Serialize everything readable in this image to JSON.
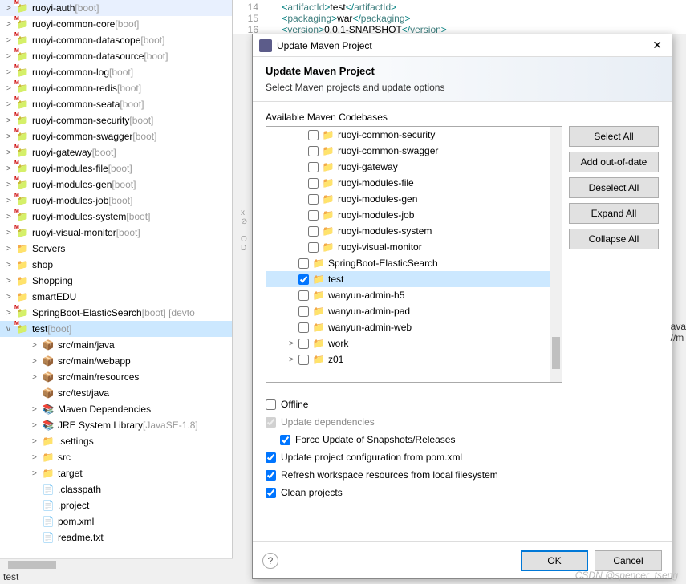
{
  "sidebar": {
    "projects": [
      {
        "name": "ruoyi-auth",
        "suffix": "[boot]",
        "icon": "maven-folder",
        "expand": ">"
      },
      {
        "name": "ruoyi-common-core",
        "suffix": "[boot]",
        "icon": "maven-folder",
        "expand": ">"
      },
      {
        "name": "ruoyi-common-datascope",
        "suffix": "[boot]",
        "icon": "maven-folder",
        "expand": ">"
      },
      {
        "name": "ruoyi-common-datasource",
        "suffix": "[boot]",
        "icon": "maven-folder",
        "expand": ">"
      },
      {
        "name": "ruoyi-common-log",
        "suffix": "[boot]",
        "icon": "maven-folder",
        "expand": ">"
      },
      {
        "name": "ruoyi-common-redis",
        "suffix": "[boot]",
        "icon": "maven-folder",
        "expand": ">"
      },
      {
        "name": "ruoyi-common-seata",
        "suffix": "[boot]",
        "icon": "maven-folder",
        "expand": ">"
      },
      {
        "name": "ruoyi-common-security",
        "suffix": "[boot]",
        "icon": "maven-folder",
        "expand": ">"
      },
      {
        "name": "ruoyi-common-swagger",
        "suffix": "[boot]",
        "icon": "maven-folder",
        "expand": ">"
      },
      {
        "name": "ruoyi-gateway",
        "suffix": "[boot]",
        "icon": "maven-folder",
        "expand": ">"
      },
      {
        "name": "ruoyi-modules-file",
        "suffix": "[boot]",
        "icon": "maven-folder",
        "expand": ">"
      },
      {
        "name": "ruoyi-modules-gen",
        "suffix": "[boot]",
        "icon": "maven-folder",
        "expand": ">"
      },
      {
        "name": "ruoyi-modules-job",
        "suffix": "[boot]",
        "icon": "maven-folder",
        "expand": ">"
      },
      {
        "name": "ruoyi-modules-system",
        "suffix": "[boot]",
        "icon": "maven-folder",
        "expand": ">"
      },
      {
        "name": "ruoyi-visual-monitor",
        "suffix": "[boot]",
        "icon": "maven-folder",
        "expand": ">"
      },
      {
        "name": "Servers",
        "suffix": "",
        "icon": "folder",
        "expand": ">"
      },
      {
        "name": "shop",
        "suffix": "",
        "icon": "folder",
        "expand": ">"
      },
      {
        "name": "Shopping",
        "suffix": "",
        "icon": "folder",
        "expand": ">"
      },
      {
        "name": "smartEDU",
        "suffix": "",
        "icon": "folder",
        "expand": ">"
      },
      {
        "name": "SpringBoot-ElasticSearch",
        "suffix": "[boot] [devto",
        "icon": "maven-folder",
        "expand": ">"
      }
    ],
    "expanded_project": {
      "name": "test",
      "suffix": "[boot]",
      "icon": "maven-folder",
      "expand": "v"
    },
    "children": [
      {
        "name": "src/main/java",
        "icon": "package",
        "expand": ">"
      },
      {
        "name": "src/main/webapp",
        "icon": "package",
        "expand": ">"
      },
      {
        "name": "src/main/resources",
        "icon": "package",
        "expand": ">"
      },
      {
        "name": "src/test/java",
        "icon": "package",
        "expand": ""
      },
      {
        "name": "Maven Dependencies",
        "icon": "library",
        "expand": ">"
      },
      {
        "name": "JRE System Library",
        "suffix": "[JavaSE-1.8]",
        "icon": "library",
        "expand": ">"
      },
      {
        "name": ".settings",
        "icon": "folder",
        "expand": ">"
      },
      {
        "name": "src",
        "icon": "folder",
        "expand": ">"
      },
      {
        "name": "target",
        "icon": "folder",
        "expand": ">"
      },
      {
        "name": ".classpath",
        "icon": "xml-file",
        "expand": ""
      },
      {
        "name": ".project",
        "icon": "xml-file",
        "expand": ""
      },
      {
        "name": "pom.xml",
        "icon": "pom-file",
        "expand": ""
      },
      {
        "name": "readme.txt",
        "icon": "text-file",
        "expand": ""
      }
    ],
    "status": "test"
  },
  "editor": {
    "lines": [
      {
        "num": "14",
        "content": [
          {
            "t": "tag",
            "v": "<"
          },
          {
            "t": "tagname",
            "v": "artifactId"
          },
          {
            "t": "tag",
            "v": ">"
          },
          {
            "t": "text",
            "v": "test"
          },
          {
            "t": "tag",
            "v": "</"
          },
          {
            "t": "tagname",
            "v": "artifactId"
          },
          {
            "t": "tag",
            "v": ">"
          }
        ]
      },
      {
        "num": "15",
        "content": [
          {
            "t": "tag",
            "v": "<"
          },
          {
            "t": "tagname",
            "v": "packaging"
          },
          {
            "t": "tag",
            "v": ">"
          },
          {
            "t": "text",
            "v": "war"
          },
          {
            "t": "tag",
            "v": "</"
          },
          {
            "t": "tagname",
            "v": "packaging"
          },
          {
            "t": "tag",
            "v": ">"
          }
        ]
      },
      {
        "num": "16",
        "content": [
          {
            "t": "tag",
            "v": "<"
          },
          {
            "t": "tagname",
            "v": "version"
          },
          {
            "t": "tag",
            "v": ">"
          },
          {
            "t": "text",
            "v": "0.0.1-SNAPSHOT"
          },
          {
            "t": "tag",
            "v": "</"
          },
          {
            "t": "tagname",
            "v": "version"
          },
          {
            "t": "tag",
            "v": ">"
          }
        ]
      }
    ]
  },
  "dialog": {
    "titlebar": "Update Maven Project",
    "heading": "Update Maven Project",
    "subheading": "Select Maven projects and update options",
    "list_label": "Available Maven Codebases",
    "items": [
      {
        "name": "ruoyi-common-security",
        "checked": false,
        "indent": 1,
        "icon": "maven"
      },
      {
        "name": "ruoyi-common-swagger",
        "checked": false,
        "indent": 1,
        "icon": "maven"
      },
      {
        "name": "ruoyi-gateway",
        "checked": false,
        "indent": 1,
        "icon": "maven"
      },
      {
        "name": "ruoyi-modules-file",
        "checked": false,
        "indent": 1,
        "icon": "maven"
      },
      {
        "name": "ruoyi-modules-gen",
        "checked": false,
        "indent": 1,
        "icon": "maven"
      },
      {
        "name": "ruoyi-modules-job",
        "checked": false,
        "indent": 1,
        "icon": "maven"
      },
      {
        "name": "ruoyi-modules-system",
        "checked": false,
        "indent": 1,
        "icon": "maven"
      },
      {
        "name": "ruoyi-visual-monitor",
        "checked": false,
        "indent": 1,
        "icon": "maven"
      },
      {
        "name": "SpringBoot-ElasticSearch",
        "checked": false,
        "indent": 2,
        "icon": "maven"
      },
      {
        "name": "test",
        "checked": true,
        "indent": 2,
        "icon": "maven",
        "highlight": true
      },
      {
        "name": "wanyun-admin-h5",
        "checked": false,
        "indent": 2,
        "icon": "maven"
      },
      {
        "name": "wanyun-admin-pad",
        "checked": false,
        "indent": 2,
        "icon": "maven"
      },
      {
        "name": "wanyun-admin-web",
        "checked": false,
        "indent": 2,
        "icon": "maven"
      },
      {
        "name": "work",
        "checked": false,
        "indent": 2,
        "icon": "folder",
        "expand": ">"
      },
      {
        "name": "z01",
        "checked": false,
        "indent": 2,
        "icon": "maven",
        "expand": ">"
      }
    ],
    "buttons": {
      "select_all": "Select All",
      "add_out": "Add out-of-date",
      "deselect_all": "Deselect All",
      "expand_all": "Expand All",
      "collapse_all": "Collapse All"
    },
    "options": {
      "offline": {
        "label": "Offline",
        "checked": false
      },
      "update_deps": {
        "label": "Update dependencies",
        "checked": true,
        "disabled": true
      },
      "force_update": {
        "label": "Force Update of Snapshots/Releases",
        "checked": true
      },
      "update_config": {
        "label": "Update project configuration from pom.xml",
        "checked": true
      },
      "refresh": {
        "label": "Refresh workspace resources from local filesystem",
        "checked": true
      },
      "clean": {
        "label": "Clean projects",
        "checked": true
      }
    },
    "footer": {
      "ok": "OK",
      "cancel": "Cancel",
      "help": "?"
    }
  },
  "watermark": "CSDN @spencer_tseng",
  "right_panel": {
    "lines": [
      "ava",
      "//m"
    ]
  }
}
